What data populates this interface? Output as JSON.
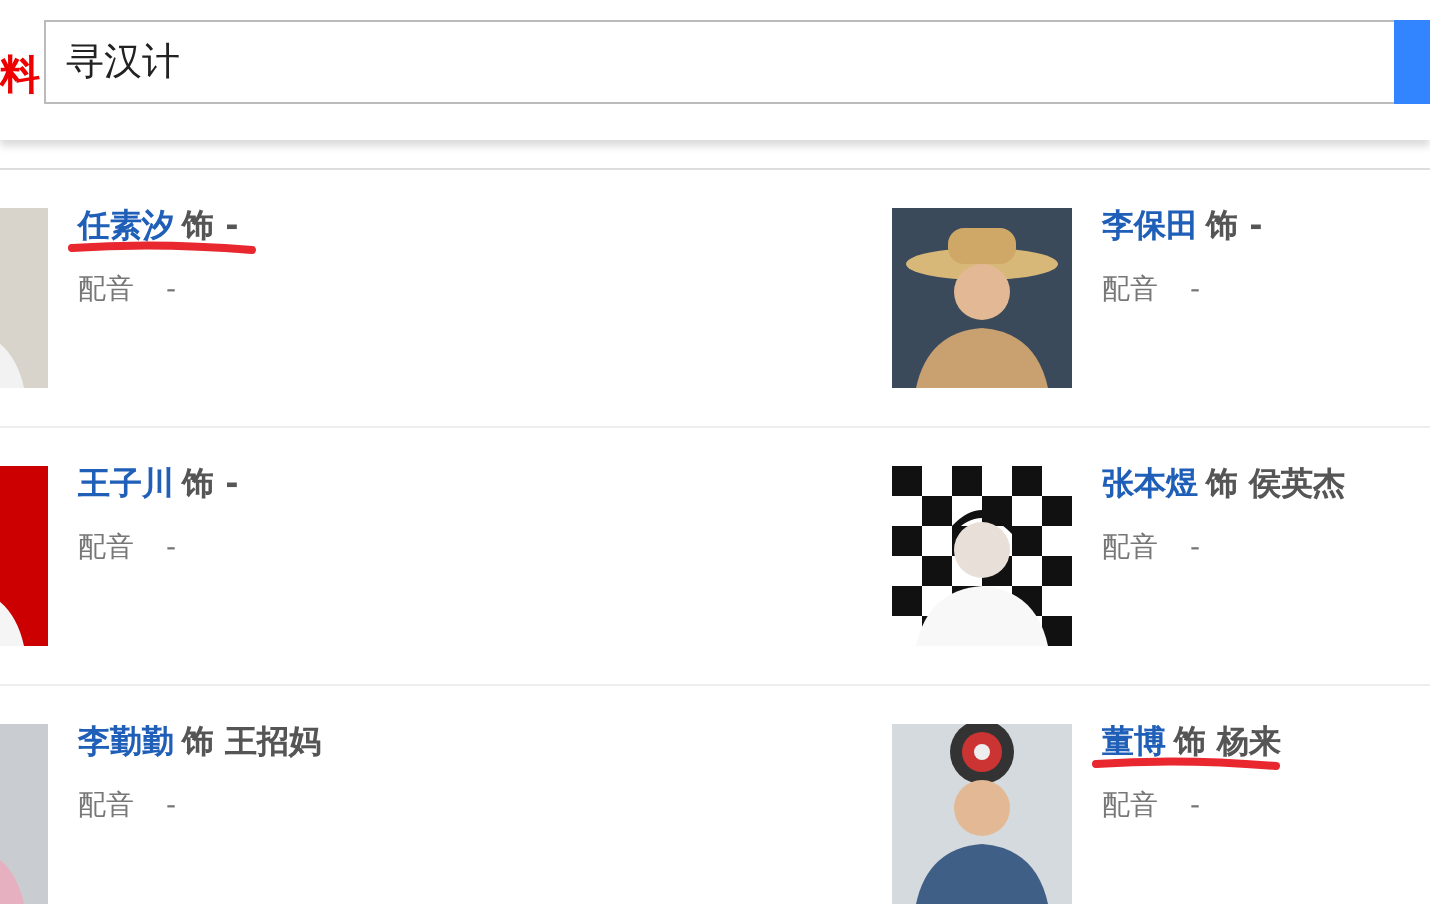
{
  "header": {
    "logo_fragment": "料",
    "search": {
      "value": "寻汉计"
    }
  },
  "cast": [
    {
      "actor": "任素汐",
      "role": "饰 -",
      "dub_label": "配音",
      "dub": "-",
      "underlined": true
    },
    {
      "actor": "李保田",
      "role": "饰 -",
      "dub_label": "配音",
      "dub": "-",
      "underlined": false
    },
    {
      "actor": "王子川",
      "role": "饰 -",
      "dub_label": "配音",
      "dub": "-",
      "underlined": false
    },
    {
      "actor": "张本煜",
      "role": "饰 侯英杰",
      "dub_label": "配音",
      "dub": "-",
      "underlined": false
    },
    {
      "actor": "李勤勤",
      "role": "饰 王招妈",
      "dub_label": "配音",
      "dub": "-",
      "underlined": false
    },
    {
      "actor": "董博",
      "role": "饰 杨来",
      "dub_label": "配音",
      "dub": "-",
      "underlined": true
    }
  ]
}
